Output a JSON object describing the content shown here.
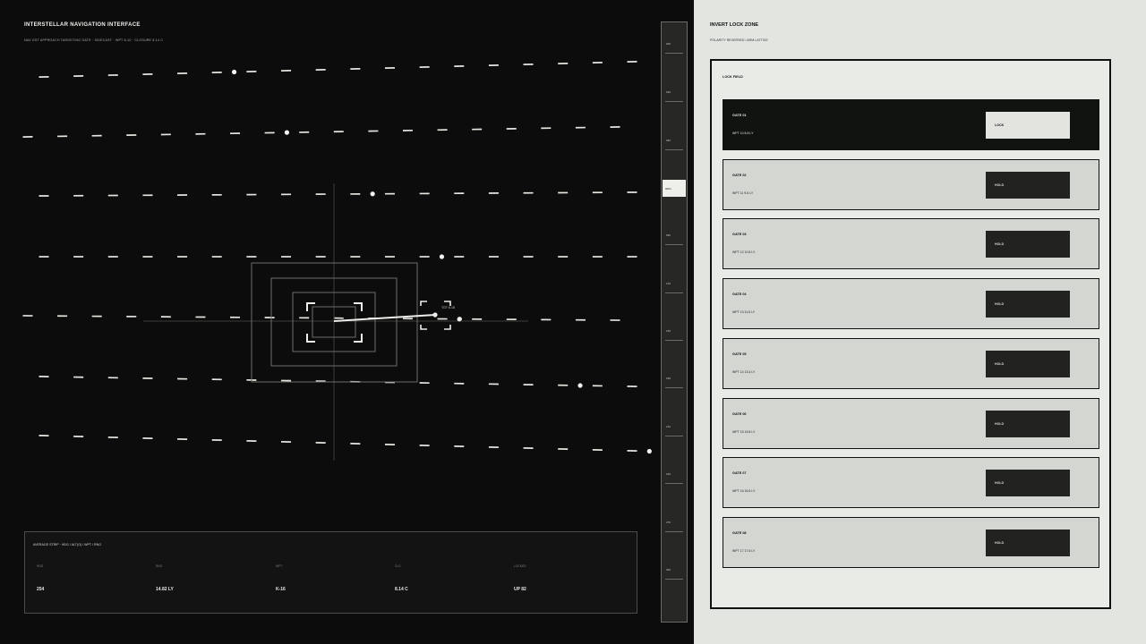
{
  "header": {
    "title": "INTERSTELLAR NAVIGATION INTERFACE",
    "subtitle": "NAV GST APPROACH TARGETING GATE · SIDECAST · WPT 6-10 · CLOSURE 8.14 C"
  },
  "nav_field": {
    "rows": [
      {
        "dot_index": 5
      },
      {
        "dot_index": 7
      },
      {
        "dot_index": 9
      },
      {
        "dot_index": 11
      },
      {
        "dot_index": 12
      },
      {
        "dot_index": 15
      },
      {
        "dot_index": 17
      }
    ],
    "target_label": "TGT 6-18",
    "reticle_label": "GST"
  },
  "telemetry": {
    "title": "AVERAGE STRIP · HDG / ALT(O) / WPT / RNG",
    "columns": [
      {
        "label": "HDG",
        "value": "254"
      },
      {
        "label": "RNG",
        "value": "14.82 LY"
      },
      {
        "label": "WPT",
        "value": "K-16"
      },
      {
        "label": "CLS",
        "value": "8.14 C"
      },
      {
        "label": "LOCKED",
        "value": "UP 82"
      }
    ]
  },
  "scale_strip": {
    "ticks": [
      "000",
      "030",
      "060",
      "090",
      "120",
      "150",
      "180",
      "210",
      "240",
      "270",
      "300",
      "330"
    ],
    "active": "HDG"
  },
  "lock_zone": {
    "title": "INVERT LOCK ZONE",
    "subtitle": "POLARITY REVERSED / ARM LATTICE",
    "field_label": "LOCK FIELD",
    "gates": [
      {
        "name": "GATE 01",
        "meta": "WPT 10  8.8 LY",
        "button": "LOCK",
        "active": true
      },
      {
        "name": "GATE 02",
        "meta": "WPT 11  9.6 LY",
        "button": "HOLD",
        "active": false
      },
      {
        "name": "GATE 03",
        "meta": "WPT 12  10.8 LY",
        "button": "HOLD",
        "active": false
      },
      {
        "name": "GATE 04",
        "meta": "WPT 13  11.6 LY",
        "button": "HOLD",
        "active": false
      },
      {
        "name": "GATE 05",
        "meta": "WPT 14  13.4 LY",
        "button": "HOLD",
        "active": false
      },
      {
        "name": "GATE 06",
        "meta": "WPT 15  15.8 LY",
        "button": "HOLD",
        "active": false
      },
      {
        "name": "GATE 07",
        "meta": "WPT 16  16.6 LY",
        "button": "HOLD",
        "active": false
      },
      {
        "name": "GATE 08",
        "meta": "WPT 17  17.6 LY",
        "button": "HOLD",
        "active": false
      }
    ]
  }
}
